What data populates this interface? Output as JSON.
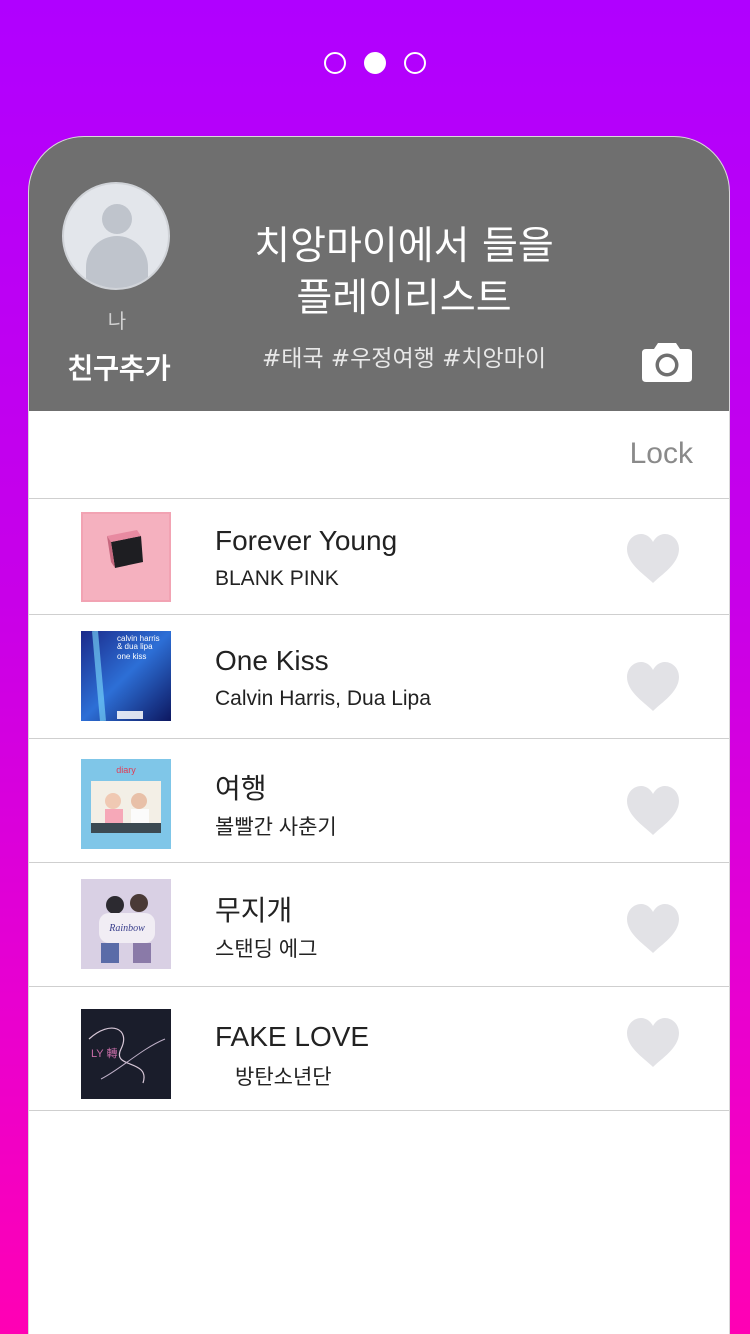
{
  "pager": {
    "count": 3,
    "active_index": 1
  },
  "profile": {
    "me_label": "나",
    "add_friend_label": "친구추가"
  },
  "playlist": {
    "title_line1": "치앙마이에서 들을",
    "title_line2": "플레이리스트",
    "tags": "#태국 #우정여행 #치앙마이",
    "camera_icon": "camera-icon"
  },
  "lock_label": "Lock",
  "songs": [
    {
      "title": "Forever Young",
      "artist": "BLANK PINK",
      "art": "album-art-forever-young"
    },
    {
      "title": "One Kiss",
      "artist": "Calvin Harris, Dua Lipa",
      "art": "album-art-one-kiss"
    },
    {
      "title": "여행",
      "artist": "볼빨간 사춘기",
      "art": "album-art-travel"
    },
    {
      "title": "무지개",
      "artist": "스탠딩 에그",
      "art": "album-art-rainbow"
    },
    {
      "title": "FAKE LOVE",
      "artist": "방탄소년단",
      "art": "album-art-fake-love"
    }
  ],
  "art_text": {
    "one_kiss_line1": "calvin harris",
    "one_kiss_line2": "& dua lipa",
    "one_kiss_line3": "one kiss",
    "travel_line1": "diary",
    "rainbow_line1": "Rainbow",
    "fake_love_line1": "LY 轉"
  },
  "colors": {
    "background_top": "#b000ff",
    "background_bottom": "#ff00b4",
    "header": "#6f6f6f",
    "heart": "#e2e2e6"
  }
}
